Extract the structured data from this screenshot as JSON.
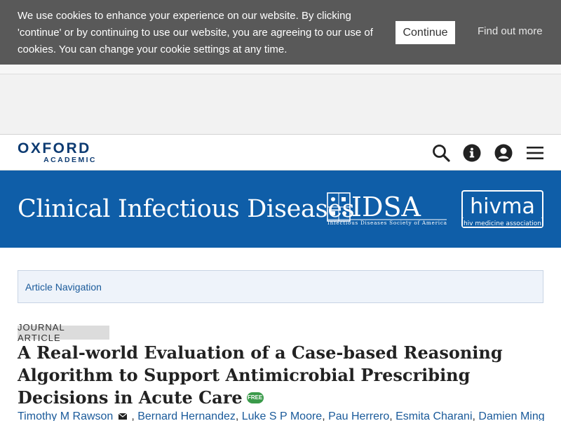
{
  "cookie_banner": {
    "text": "We use cookies to enhance your experience on our website. By clicking 'continue' or by continuing to use our website, you are agreeing to our use of cookies. You can change your cookie settings at any time.",
    "continue_label": "Continue",
    "find_out_more_label": "Find out more"
  },
  "header": {
    "logo_main": "OXFORD",
    "logo_sub": "ACADEMIC",
    "icons": [
      "search-icon",
      "info-icon",
      "account-icon",
      "menu-icon"
    ]
  },
  "journal": {
    "title": "Clinical Infectious Diseases",
    "partner1_name": "IDSA",
    "partner1_sub": "Infectious Diseases Society of America",
    "partner2_name": "hivma",
    "partner2_sub": "hiv medicine association",
    "banner_color": "#0f5ea8"
  },
  "article_nav": {
    "label": "Article Navigation"
  },
  "article": {
    "type_tag": "JOURNAL ARTICLE",
    "title": "A Real-world Evaluation of a Case-based Reasoning Algorithm to Support Antimicrobial Prescribing Decisions in Acute Care",
    "free_badge": "FREE",
    "authors": [
      "Timothy M Rawson",
      "Bernard Hernandez",
      "Luke S P Moore",
      "Pau Herrero",
      "Esmita Charani",
      "Damien Ming"
    ]
  }
}
